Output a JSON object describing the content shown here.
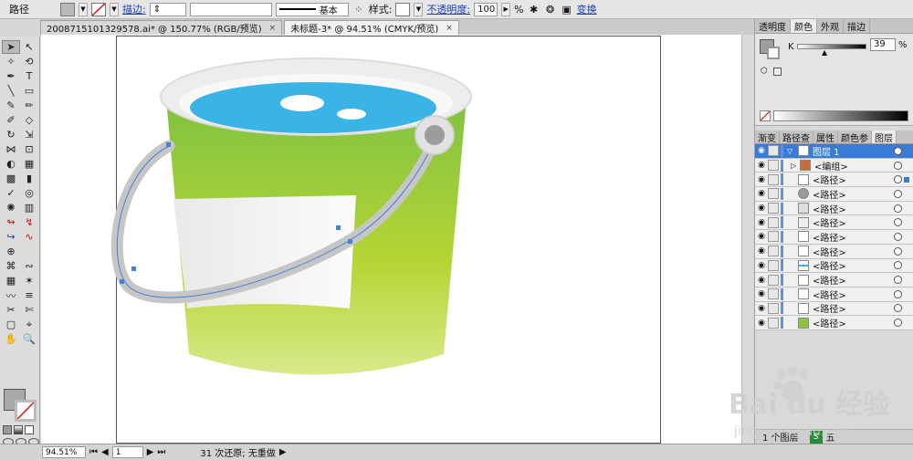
{
  "control_bar": {
    "selection_label": "路径",
    "stroke_link": "描边:",
    "profile_label": "基本",
    "style_label": "样式:",
    "opacity_link": "不透明度:",
    "opacity_value": "100",
    "opacity_unit": "%",
    "transform_link": "变换"
  },
  "tabs": [
    {
      "title": "2008715101329578.ai* @ 150.77% (RGB/预览)",
      "close": "×"
    },
    {
      "title": "未标题-3* @ 94.51% (CMYK/预览)",
      "close": "×"
    }
  ],
  "status": {
    "zoom": "94.51%",
    "page": "1",
    "undo_text": "31 次还原; 无重做"
  },
  "panels": {
    "top_tabs": [
      "透明度",
      "颜色",
      "外观",
      "描边"
    ],
    "k_label": "K",
    "k_value": "39",
    "k_unit": "%",
    "layer_tabs": [
      "渐变",
      "路径查",
      "属性",
      "颜色参",
      "图层"
    ],
    "layers": [
      {
        "name": "图层 1"
      },
      {
        "name": "<编组>"
      },
      {
        "name": "<路径>"
      },
      {
        "name": "<路径>"
      },
      {
        "name": "<路径>"
      },
      {
        "name": "<路径>"
      },
      {
        "name": "<路径>"
      },
      {
        "name": "<路径>"
      },
      {
        "name": "<路径>"
      },
      {
        "name": "<路径>"
      },
      {
        "name": "<路径>"
      },
      {
        "name": "<路径>"
      },
      {
        "name": "<路径>"
      }
    ],
    "layers_count": "1 个图层",
    "ime_label": "五"
  },
  "watermark": {
    "brand": "Bai du 经验",
    "url": "jingyan.baidu.com"
  },
  "colors": {
    "accent": "#3a7bd5",
    "bucket_green": "#8cc63f",
    "water_blue": "#3ab4e6"
  }
}
